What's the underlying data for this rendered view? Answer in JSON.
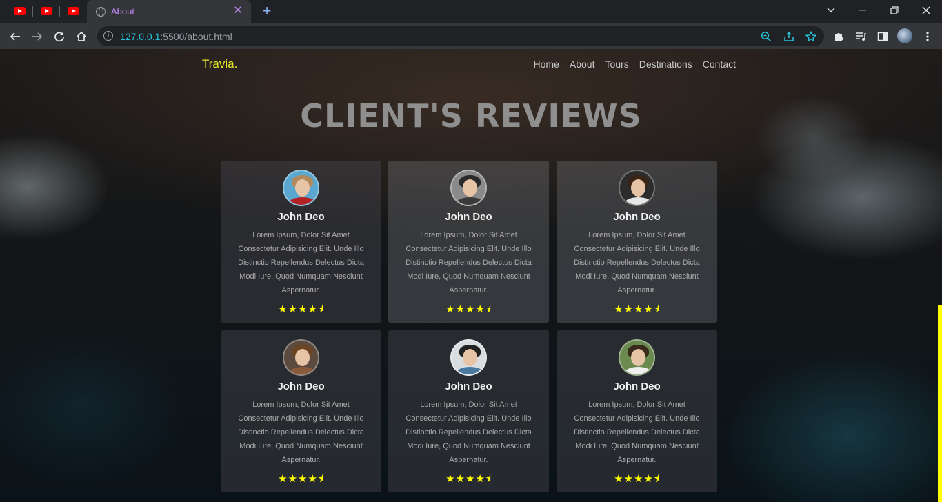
{
  "browser": {
    "tab_title": "About",
    "url_host": "127.0.0.1",
    "url_rest": ":5500/about.html"
  },
  "site": {
    "logo": "Travia.",
    "nav": [
      "Home",
      "About",
      "Tours",
      "Destinations",
      "Contact"
    ],
    "heading": "CLIENT'S REVIEWS"
  },
  "reviews": [
    {
      "name": "John Deo",
      "text": "Lorem Ipsum, Dolor Sit Amet Consectetur Adipisicing Elit. Unde Illo Distinctio Repellendus Delectus Dicta Modi Iure, Quod Numquam Nesciunt Aspernatur.",
      "rating": 4.5,
      "stars": "★★★★⯨"
    },
    {
      "name": "John Deo",
      "text": "Lorem Ipsum, Dolor Sit Amet Consectetur Adipisicing Elit. Unde Illo Distinctio Repellendus Delectus Dicta Modi Iure, Quod Numquam Nesciunt Aspernatur.",
      "rating": 4.5,
      "stars": "★★★★⯨"
    },
    {
      "name": "John Deo",
      "text": "Lorem Ipsum, Dolor Sit Amet Consectetur Adipisicing Elit. Unde Illo Distinctio Repellendus Delectus Dicta Modi Iure, Quod Numquam Nesciunt Aspernatur.",
      "rating": 4.5,
      "stars": "★★★★⯨"
    },
    {
      "name": "John Deo",
      "text": "Lorem Ipsum, Dolor Sit Amet Consectetur Adipisicing Elit. Unde Illo Distinctio Repellendus Delectus Dicta Modi Iure, Quod Numquam Nesciunt Aspernatur.",
      "rating": 4.5,
      "stars": "★★★★⯨"
    },
    {
      "name": "John Deo",
      "text": "Lorem Ipsum, Dolor Sit Amet Consectetur Adipisicing Elit. Unde Illo Distinctio Repellendus Delectus Dicta Modi Iure, Quod Numquam Nesciunt Aspernatur.",
      "rating": 4.5,
      "stars": "★★★★⯨"
    },
    {
      "name": "John Deo",
      "text": "Lorem Ipsum, Dolor Sit Amet Consectetur Adipisicing Elit. Unde Illo Distinctio Repellendus Delectus Dicta Modi Iure, Quod Numquam Nesciunt Aspernatur.",
      "rating": 4.5,
      "stars": "★★★★⯨"
    }
  ],
  "colors": {
    "logo": "#e8e82a",
    "stars": "#ffff00",
    "tab_accent": "#c58af9",
    "url_host": "#26c6da"
  }
}
